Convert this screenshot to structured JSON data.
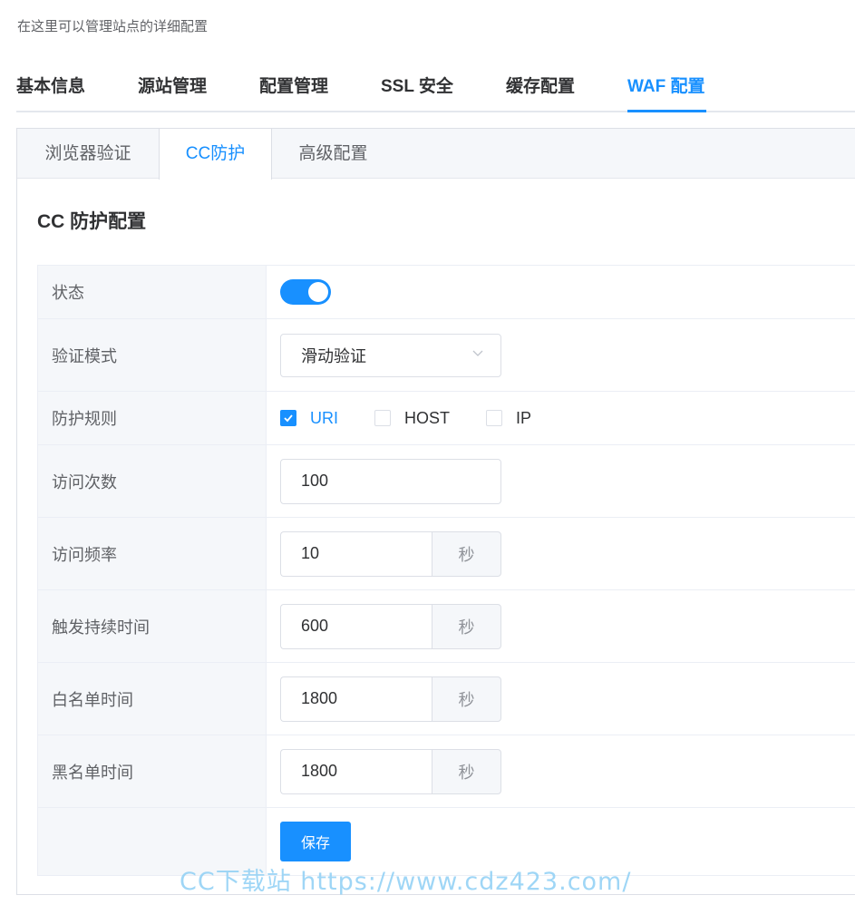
{
  "header": {
    "subtitle": "在这里可以管理站点的详细配置"
  },
  "main_tabs": [
    {
      "label": "基本信息"
    },
    {
      "label": "源站管理"
    },
    {
      "label": "配置管理"
    },
    {
      "label": "SSL 安全"
    },
    {
      "label": "缓存配置"
    },
    {
      "label": "WAF 配置",
      "active": true
    }
  ],
  "sub_tabs": [
    {
      "label": "浏览器验证"
    },
    {
      "label": "CC防护",
      "active": true
    },
    {
      "label": "高级配置"
    }
  ],
  "section": {
    "title": "CC 防护配置"
  },
  "form": {
    "status": {
      "label": "状态",
      "enabled": true
    },
    "mode": {
      "label": "验证模式",
      "value": "滑动验证"
    },
    "rules": {
      "label": "防护规则",
      "options": [
        {
          "label": "URI",
          "checked": true
        },
        {
          "label": "HOST",
          "checked": false
        },
        {
          "label": "IP",
          "checked": false
        }
      ]
    },
    "visits": {
      "label": "访问次数",
      "value": "100"
    },
    "frequency": {
      "label": "访问频率",
      "value": "10",
      "unit": "秒"
    },
    "trigger_duration": {
      "label": "触发持续时间",
      "value": "600",
      "unit": "秒"
    },
    "whitelist_time": {
      "label": "白名单时间",
      "value": "1800",
      "unit": "秒"
    },
    "blacklist_time": {
      "label": "黑名单时间",
      "value": "1800",
      "unit": "秒"
    },
    "save_label": "保存"
  },
  "watermark": "CC下载站 https://www.cdz423.com/",
  "colors": {
    "accent": "#1890ff",
    "label_bg": "#f5f7fa",
    "border": "#ebeef5"
  }
}
